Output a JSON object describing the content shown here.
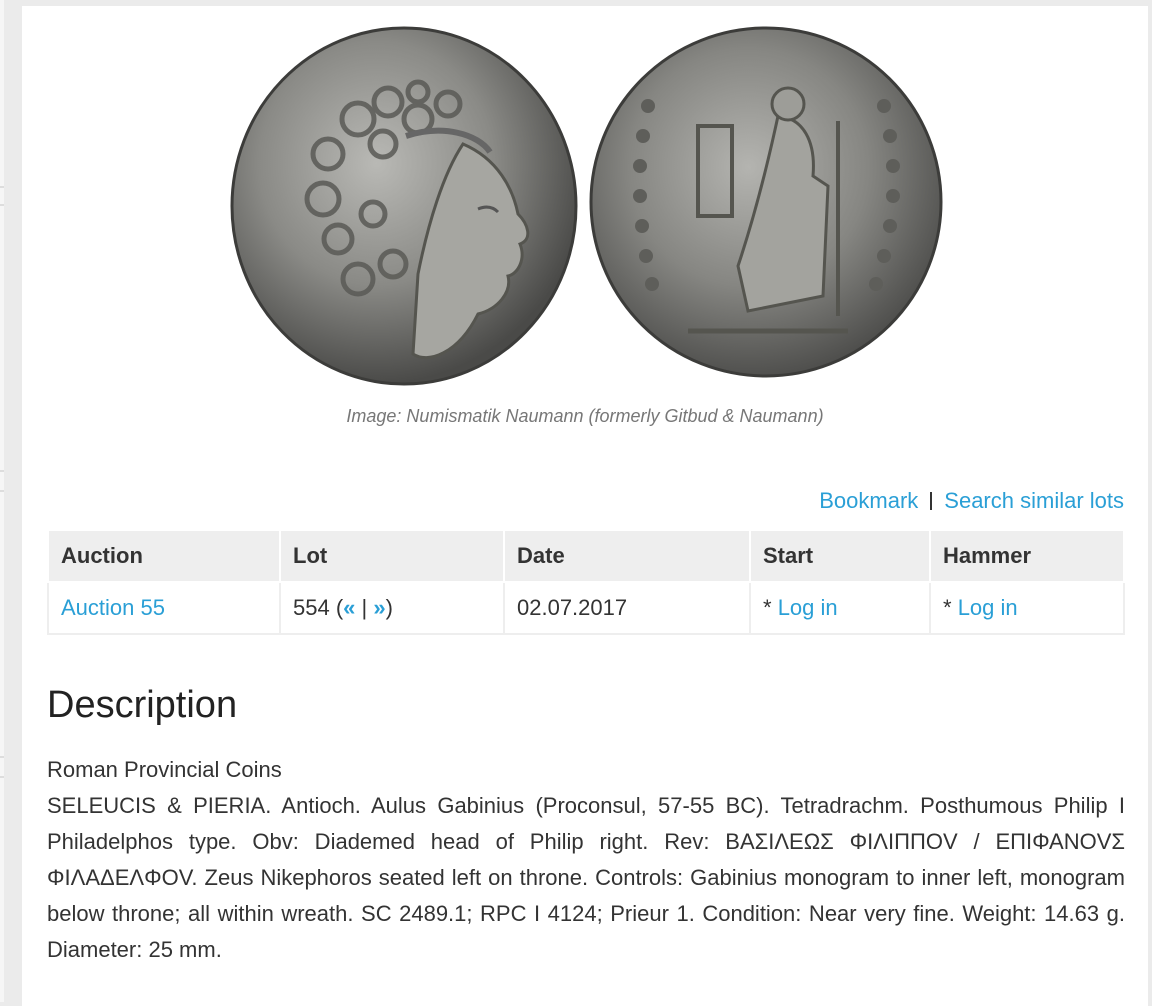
{
  "image": {
    "alt": "Coin obverse and reverse",
    "caption": "Image: Numismatik Naumann (formerly Gitbud & Naumann)"
  },
  "actions": {
    "bookmark": "Bookmark",
    "search_similar": "Search similar lots"
  },
  "table": {
    "headers": [
      "Auction",
      "Lot",
      "Date",
      "Start",
      "Hammer"
    ],
    "row": {
      "auction": "Auction 55",
      "lot_number": "554",
      "lot_open": "(",
      "prev": "«",
      "divider": "|",
      "next": "»",
      "lot_close": ")",
      "date": "02.07.2017",
      "start_prefix": "* ",
      "start_link": "Log in",
      "hammer_prefix": "* ",
      "hammer_link": "Log in"
    }
  },
  "description": {
    "title": "Description",
    "category": "Roman Provincial Coins",
    "text": "SELEUCIS & PIERIA. Antioch. Aulus Gabinius (Proconsul, 57-55 BC). Tetradrachm. Posthumous Philip I Philadelphos type. Obv: Diademed head of Philip right. Rev: ΒΑΣΙΛΕΩΣ ΦΙΛΙΠΠΟV / ΕΠΙΦΑΝΟVΣ ΦΙΛΑΔΕΛΦΟV. Zeus Nikephoros seated left on throne. Controls: Gabinius monogram to inner left, monogram below throne; all within wreath. SC 2489.1; RPC I 4124; Prieur 1. Condition: Near very fine. Weight: 14.63 g. Diameter: 25 mm."
  },
  "colors": {
    "link": "#2a9fd6",
    "table_header_bg": "#eeeeee",
    "page_bg": "#ebebeb"
  }
}
